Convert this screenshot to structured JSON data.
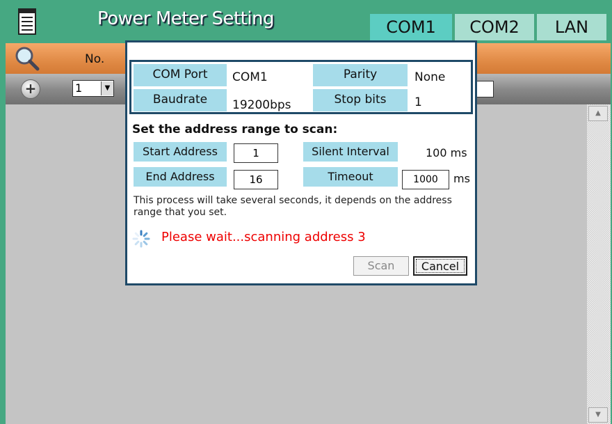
{
  "app": {
    "title": "Power Meter Setting",
    "tabs": [
      {
        "label": "COM1",
        "active": true
      },
      {
        "label": "COM2",
        "active": false
      },
      {
        "label": "LAN",
        "active": false
      }
    ],
    "menu_icon": "document-list-icon"
  },
  "list_header": {
    "search_icon": "magnifier-icon",
    "columns": [
      "No."
    ]
  },
  "toolbar": {
    "add_icon": "plus-circle-icon",
    "address_select_value": "1",
    "address_select_arrow_icon": "chevron-down-icon"
  },
  "dialog": {
    "port": {
      "com_port_label": "COM Port",
      "com_port_value": "COM1",
      "parity_label": "Parity",
      "parity_value": "None",
      "baudrate_label": "Baudrate",
      "baudrate_value": "19200bps",
      "stop_bits_label": "Stop bits",
      "stop_bits_value": "1"
    },
    "scan_heading": "Set the address range to scan:",
    "start_address_label": "Start Address",
    "start_address_value": "1",
    "end_address_label": "End Address",
    "end_address_value": "16",
    "silent_interval_label": "Silent Interval",
    "silent_interval_value": "100 ms",
    "timeout_label": "Timeout",
    "timeout_value": "1000",
    "timeout_unit": "ms",
    "info_text": "This process will take several seconds, it depends on the address range that you set.",
    "status_text": "Please wait...scanning address 3",
    "spinner_icon": "loading-spinner-icon",
    "scan_button": "Scan",
    "cancel_button": "Cancel",
    "colors": {
      "status": "#ee0000",
      "label_bg": "#a6dcea",
      "border": "#1f4a68"
    }
  },
  "colors": {
    "title_bg": "#46a882",
    "tab_active": "#5ccdc2",
    "tab_inactive": "#a9ded0",
    "header_orange": "#e08a45"
  }
}
